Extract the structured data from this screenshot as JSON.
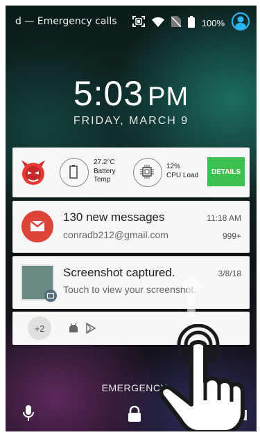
{
  "status_bar": {
    "carrier_text": "d — Emergency calls",
    "battery_percent": "100%",
    "icons": [
      "screenshot-icon",
      "wifi-icon",
      "no-sim-icon",
      "battery-icon",
      "account-icon"
    ]
  },
  "lockscreen": {
    "time": "5:03",
    "ampm": "PM",
    "date": "FRIDAY, MARCH 9",
    "emergency_label": "EMERGENCY"
  },
  "notifications": {
    "antutu": {
      "battery_temp_value": "27.2°C",
      "battery_temp_label_1": "Battery",
      "battery_temp_label_2": "Temp",
      "cpu_value": "12%",
      "cpu_label": "CPU Load",
      "details_label": "DETAILS",
      "accent": "#3cc150"
    },
    "gmail": {
      "title": "130 new messages",
      "account": "conradb212@gmail.com",
      "time": "11:18 AM",
      "count": "999+",
      "icon_color": "#db4437"
    },
    "screenshot": {
      "title": "Screenshot captured.",
      "subtitle": "Touch to view your screenshot.",
      "date": "3/8/18"
    },
    "overflow": {
      "count": "+2"
    }
  },
  "colors": {
    "card_bg": "#f7f7f7",
    "account_icon": "#29b6f6"
  }
}
